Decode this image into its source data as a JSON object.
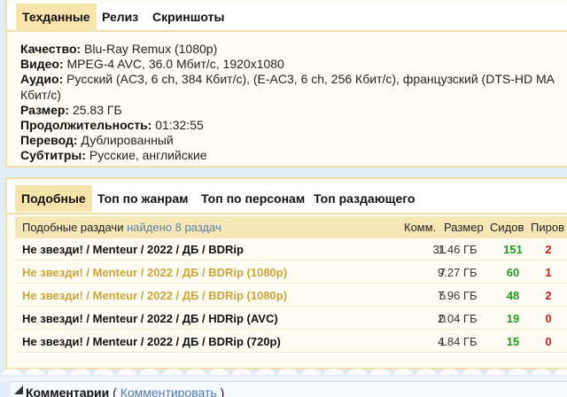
{
  "info_tabs": [
    "Техданные",
    "Релиз",
    "Скриншоты"
  ],
  "tech": [
    {
      "label": "Качество:",
      "value": " Blu-Ray Remux (1080p)"
    },
    {
      "label": "Видео:",
      "value": " MPEG-4 AVC, 36.0 Мбит/с, 1920x1080"
    },
    {
      "label": "Аудио:",
      "value": " Русский (AC3, 6 ch, 384 Кбит/с), (E-AC3, 6 ch, 256 Кбит/с), французский (DTS-HD MA"
    },
    {
      "label": "",
      "value": "Кбит/с)"
    },
    {
      "label": "Размер:",
      "value": " 25.83 ГБ"
    },
    {
      "label": "Продолжительность:",
      "value": " 01:32:55"
    },
    {
      "label": "Перевод:",
      "value": " Дублированный"
    },
    {
      "label": "Субтитры:",
      "value": " Русские, английские"
    }
  ],
  "similar_tabs": [
    "Подобные",
    "Топ по жанрам",
    "Топ по персонам",
    "Топ раздающего"
  ],
  "table": {
    "title": "Подобные раздачи",
    "found": "найдено 8 раздач",
    "columns": [
      "Комм.",
      "Размер",
      "Сидов",
      "Пиров"
    ],
    "rows": [
      {
        "title": "Не звезди! / Menteur / 2022 / ДБ / BDRip",
        "comments": "31",
        "size": "1.46 ГБ",
        "seeds": "151",
        "peers": "2",
        "highlight": false
      },
      {
        "title": "Не звезди! / Menteur / 2022 / ДБ / BDRip (1080p)",
        "comments": "7",
        "size": "9.27 ГБ",
        "seeds": "60",
        "peers": "1",
        "highlight": true
      },
      {
        "title": "Не звезди! / Menteur / 2022 / ДБ / BDRip (1080p)",
        "comments": "5",
        "size": "7.96 ГБ",
        "seeds": "48",
        "peers": "2",
        "highlight": true
      },
      {
        "title": "Не звезди! / Menteur / 2022 / ДБ / HDRip (AVC)",
        "comments": "0",
        "size": "2.04 ГБ",
        "seeds": "19",
        "peers": "0",
        "highlight": false
      },
      {
        "title": "Не звезди! / Menteur / 2022 / ДБ / BDRip (720p)",
        "comments": "1",
        "size": "4.84 ГБ",
        "seeds": "15",
        "peers": "0",
        "highlight": false
      }
    ]
  },
  "comments": {
    "label": "Комментарии",
    "open": " ( ",
    "link": "Комментировать",
    "close": " )"
  },
  "colors": {
    "panel_bg": "#fffdf3",
    "panel_border": "#f1deaa",
    "active_tab": "#f7e4aa",
    "seeds": "#1f9a1f",
    "peers": "#c91f1f",
    "highlight_title": "#cba43b",
    "link": "#4f79a8"
  },
  "icons": {
    "comments_toggle": "fold-triangle-icon"
  }
}
